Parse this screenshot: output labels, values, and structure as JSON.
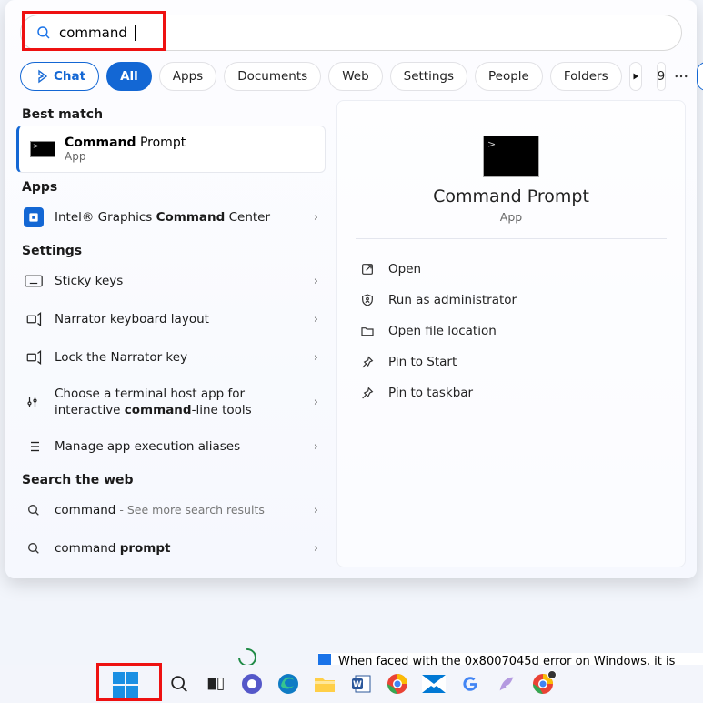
{
  "search": {
    "query": "command"
  },
  "filters": {
    "chat": "Chat",
    "all": "All",
    "apps": "Apps",
    "documents": "Documents",
    "web": "Web",
    "settings": "Settings",
    "people": "People",
    "folders": "Folders",
    "badge": "9"
  },
  "sections": {
    "best_match": "Best match",
    "apps": "Apps",
    "settings": "Settings",
    "search_web": "Search the web"
  },
  "best_match": {
    "title_bold": "Command",
    "title_rest": " Prompt",
    "subtitle": "App"
  },
  "apps_list": [
    {
      "prefix": "Intel® Graphics ",
      "bold": "Command",
      "suffix": " Center"
    }
  ],
  "settings_list": [
    {
      "text": "Sticky keys"
    },
    {
      "text": "Narrator keyboard layout"
    },
    {
      "text": "Lock the Narrator key"
    },
    {
      "prefix": "Choose a terminal host app for interactive ",
      "bold": "command",
      "suffix": "-line tools"
    },
    {
      "text": "Manage app execution aliases"
    }
  ],
  "web_list": [
    {
      "text": "command",
      "sub": " - See more search results"
    },
    {
      "prefix": "command ",
      "bold": "prompt"
    }
  ],
  "preview": {
    "title": "Command Prompt",
    "subtitle": "App",
    "actions": {
      "open": "Open",
      "run_admin": "Run as administrator",
      "open_loc": "Open file location",
      "pin_start": "Pin to Start",
      "pin_taskbar": "Pin to taskbar"
    }
  },
  "pagestrip": "When faced with the 0x8007045d error on Windows, it is"
}
